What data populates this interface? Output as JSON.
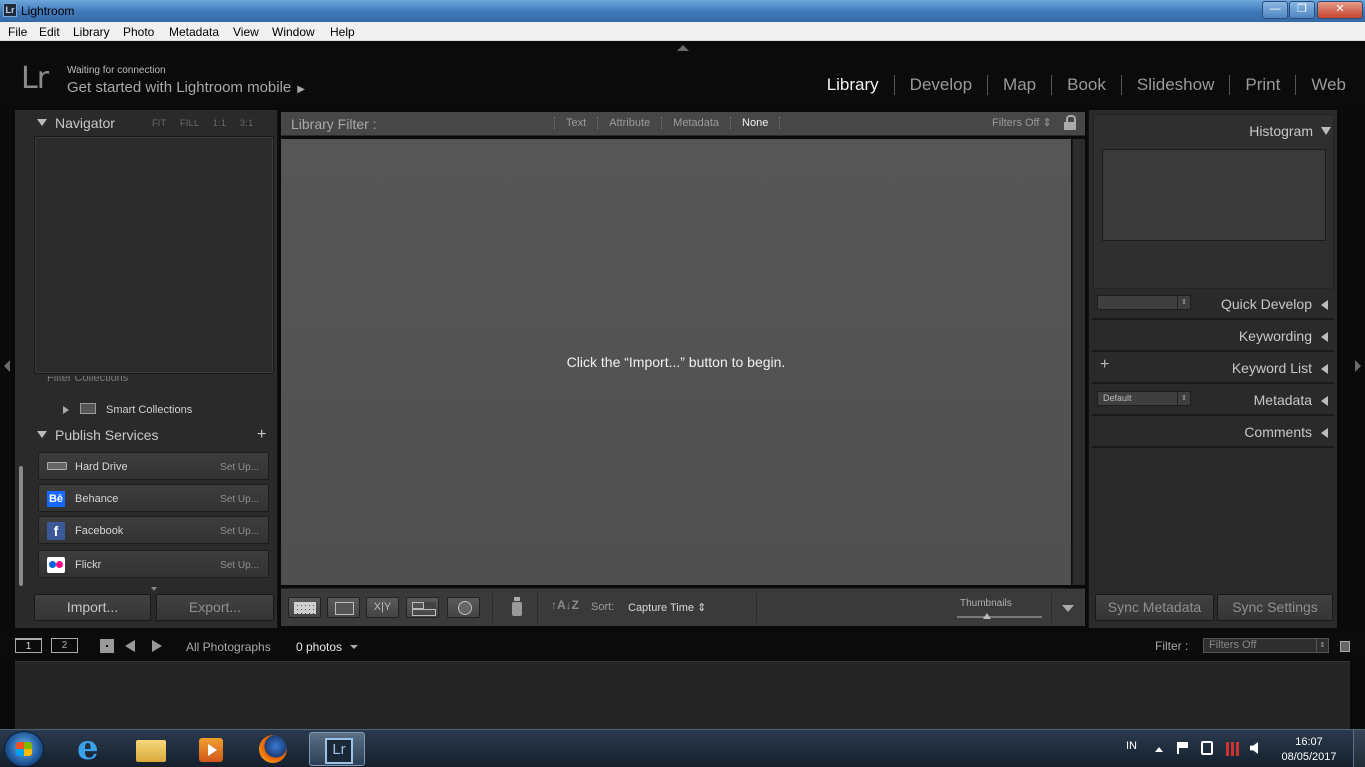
{
  "window": {
    "title": "Lightroom",
    "app_icon": "Lr",
    "controls": {
      "minimize": "—",
      "maximize": "❐",
      "close": "✕"
    }
  },
  "menu": [
    "File",
    "Edit",
    "Library",
    "Photo",
    "Metadata",
    "View",
    "Window",
    "Help"
  ],
  "identity": {
    "logo": "Lr",
    "status": "Waiting for connection",
    "mobile_link": "Get started with Lightroom mobile"
  },
  "modules": [
    {
      "label": "Library",
      "active": true
    },
    {
      "label": "Develop",
      "active": false
    },
    {
      "label": "Map",
      "active": false
    },
    {
      "label": "Book",
      "active": false
    },
    {
      "label": "Slideshow",
      "active": false
    },
    {
      "label": "Print",
      "active": false
    },
    {
      "label": "Web",
      "active": false
    }
  ],
  "left_panel": {
    "navigator": {
      "title": "Navigator",
      "zoom_options": [
        "FIT",
        "FILL",
        "1:1",
        "3:1"
      ]
    },
    "filter_collections": "Filter Collections",
    "smart_collections": "Smart Collections",
    "publish_services": {
      "title": "Publish Services",
      "add": "+",
      "services": [
        {
          "name": "Hard Drive",
          "action": "Set Up..."
        },
        {
          "name": "Behance",
          "action": "Set Up...",
          "icon_text": "Bē"
        },
        {
          "name": "Facebook",
          "action": "Set Up...",
          "icon_text": "f"
        },
        {
          "name": "Flickr",
          "action": "Set Up..."
        }
      ]
    },
    "import_label": "Import...",
    "export_label": "Export..."
  },
  "library_filter": {
    "title": "Library Filter :",
    "tabs": [
      "Text",
      "Attribute",
      "Metadata",
      "None"
    ],
    "active_tab": "None",
    "preset": "Filters Off"
  },
  "grid": {
    "empty_message": "Click the “Import...” button to begin."
  },
  "toolbar": {
    "compare_label": "X|Y",
    "sort_direction": "↑A↓Z",
    "sort_label": "Sort:",
    "sort_value": "Capture Time",
    "thumbnails_label": "Thumbnails",
    "thumbnail_size": 0.35
  },
  "right_panel": {
    "histogram": "Histogram",
    "quick_develop": "Quick Develop",
    "keywording": "Keywording",
    "keyword_list": "Keyword List",
    "keyword_add": "+",
    "metadata": "Metadata",
    "metadata_preset": "Default",
    "comments": "Comments",
    "sync_metadata": "Sync Metadata",
    "sync_settings": "Sync Settings"
  },
  "filmstrip": {
    "screen_1": "1",
    "screen_2": "2",
    "source": "All Photographs",
    "count": "0 photos",
    "filter_label": "Filter :",
    "filter_value": "Filters Off"
  },
  "taskbar": {
    "language": "IN",
    "time": "16:07",
    "date": "08/05/2017",
    "apps": [
      "internet-explorer",
      "windows-explorer",
      "media-player",
      "firefox",
      "lightroom"
    ]
  }
}
